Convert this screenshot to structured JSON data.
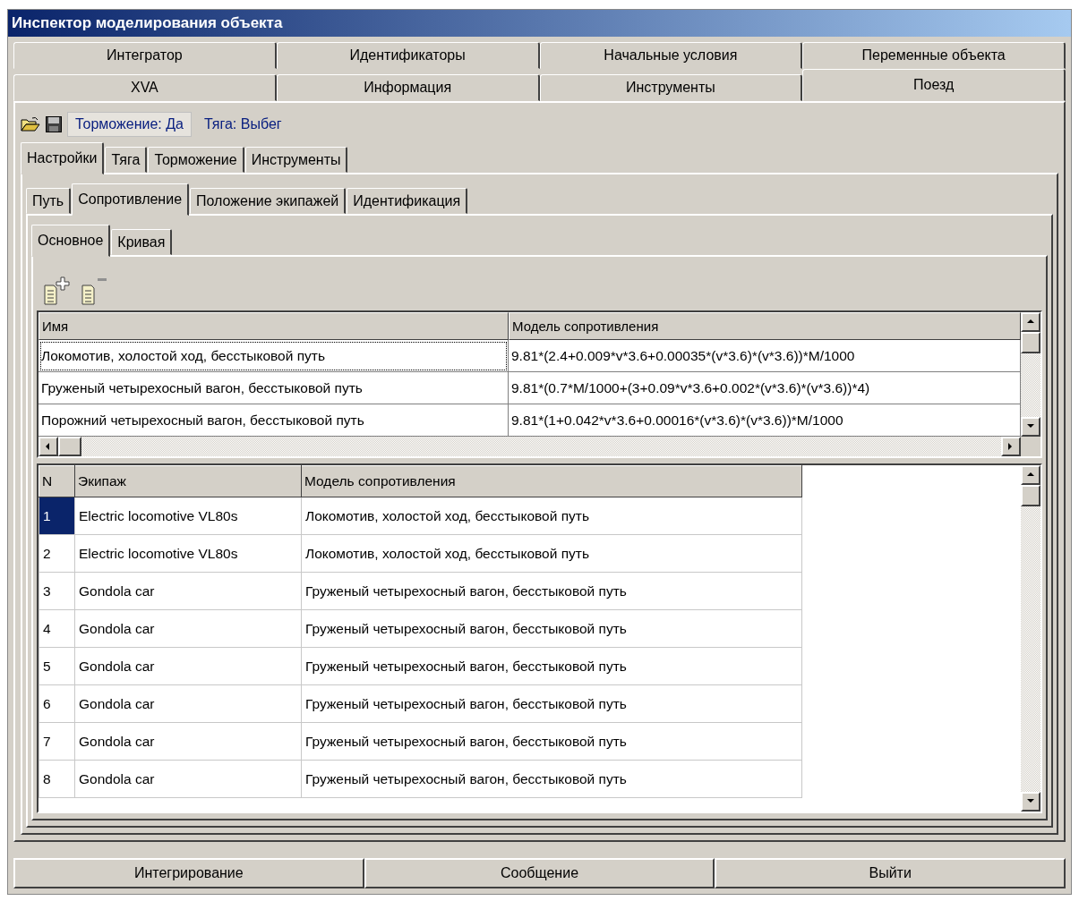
{
  "window": {
    "title": "Инспектор моделирования объекта"
  },
  "tab_rows": [
    [
      {
        "label": "Интегратор",
        "selected": false
      },
      {
        "label": "Идентификаторы",
        "selected": false
      },
      {
        "label": "Начальные условия",
        "selected": false
      },
      {
        "label": "Переменные объекта",
        "selected": false
      }
    ],
    [
      {
        "label": "XVA",
        "selected": false
      },
      {
        "label": "Информация",
        "selected": false
      },
      {
        "label": "Инструменты",
        "selected": false
      },
      {
        "label": "Поезд",
        "selected": true
      }
    ]
  ],
  "toolbar": {
    "status": [
      {
        "text": "Торможение: Да",
        "framed": true
      },
      {
        "text": "Тяга: Выбег",
        "framed": false
      }
    ]
  },
  "train_tabs": [
    {
      "label": "Настройки",
      "selected": true
    },
    {
      "label": "Тяга",
      "selected": false
    },
    {
      "label": "Торможение",
      "selected": false
    },
    {
      "label": "Инструменты",
      "selected": false
    }
  ],
  "settings_tabs": [
    {
      "label": "Путь",
      "selected": false
    },
    {
      "label": "Сопротивление",
      "selected": true
    },
    {
      "label": "Положение экипажей",
      "selected": false
    },
    {
      "label": "Идентификация",
      "selected": false
    }
  ],
  "resistance_tabs": [
    {
      "label": "Основное",
      "selected": true
    },
    {
      "label": "Кривая",
      "selected": false
    }
  ],
  "models_table": {
    "columns": [
      "Имя",
      "Модель сопротивления"
    ],
    "rows": [
      {
        "name": "Локомотив, холостой ход, бесстыковой путь",
        "model": "9.81*(2.4+0.009*v*3.6+0.00035*(v*3.6)*(v*3.6))*M/1000",
        "selected": true
      },
      {
        "name": "Груженый четырехосный вагон, бесстыковой путь",
        "model": "9.81*(0.7*M/1000+(3+0.09*v*3.6+0.002*(v*3.6)*(v*3.6))*4)",
        "selected": false
      },
      {
        "name": "Порожний четырехосный вагон, бесстыковой путь",
        "model": "9.81*(1+0.042*v*3.6+0.00016*(v*3.6)*(v*3.6))*M/1000",
        "selected": false
      }
    ]
  },
  "crew_table": {
    "columns": [
      "N",
      "Экипаж",
      "Модель сопротивления"
    ],
    "rows": [
      {
        "n": "1",
        "crew": "Electric locomotive VL80s",
        "model": "Локомотив, холостой ход, бесстыковой путь",
        "selected": true
      },
      {
        "n": "2",
        "crew": "Electric locomotive VL80s",
        "model": "Локомотив, холостой ход, бесстыковой путь",
        "selected": false
      },
      {
        "n": "3",
        "crew": "Gondola car",
        "model": "Груженый четырехосный вагон, бесстыковой путь",
        "selected": false
      },
      {
        "n": "4",
        "crew": "Gondola car",
        "model": "Груженый четырехосный вагон, бесстыковой путь",
        "selected": false
      },
      {
        "n": "5",
        "crew": "Gondola car",
        "model": "Груженый четырехосный вагон, бесстыковой путь",
        "selected": false
      },
      {
        "n": "6",
        "crew": "Gondola car",
        "model": "Груженый четырехосный вагон, бесстыковой путь",
        "selected": false
      },
      {
        "n": "7",
        "crew": "Gondola car",
        "model": "Груженый четырехосный вагон, бесстыковой путь",
        "selected": false
      },
      {
        "n": "8",
        "crew": "Gondola car",
        "model": "Груженый четырехосный вагон, бесстыковой путь",
        "selected": false
      }
    ]
  },
  "buttons": [
    "Интегрирование",
    "Сообщение",
    "Выйти"
  ]
}
